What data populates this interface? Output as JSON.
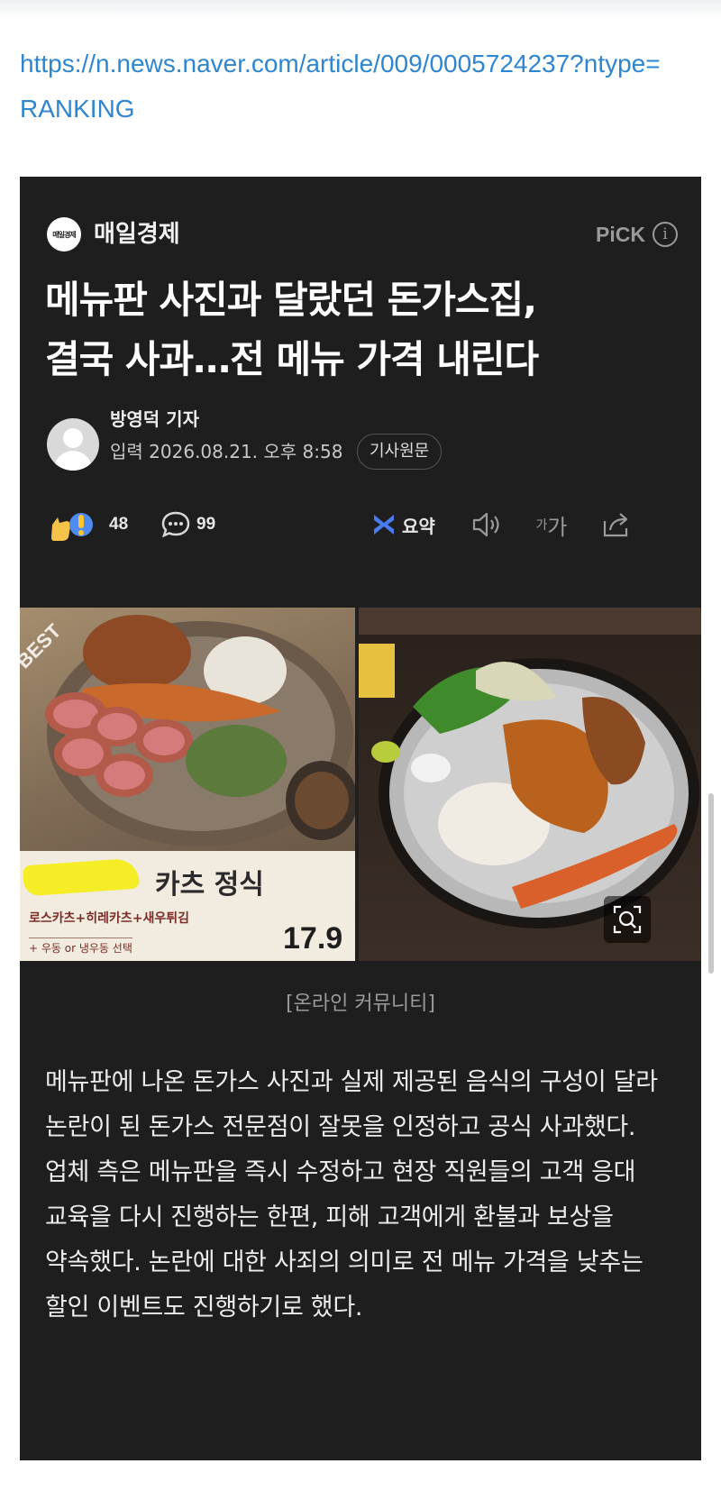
{
  "source_link": "https://n.news.naver.com/article/009/0005724237?ntype=RANKING",
  "article": {
    "press_logo_text": "매일경제",
    "press_name": "매일경제",
    "pick_label": "PiCK",
    "headline_line1": "메뉴판 사진과 달랐던 돈가스집,",
    "headline_line2": "결국 사과…전 메뉴 가격 내린다",
    "reporter": "방영덕 기자",
    "date_label": "입력",
    "date_value": "2026.08.21. 오후 8:58",
    "original_button": "기사원문",
    "reaction_count": "48",
    "comment_count": "99",
    "summary_label": "요약",
    "font_size_label_small": "가",
    "font_size_label_large": "가",
    "photo": {
      "best_tag": "BEST",
      "menu_title": "카츠 정식",
      "menu_sub": "로스카츠+히레카츠+새우튀김",
      "menu_option": "+ 우동 or 냉우동 선택",
      "menu_price": "17.9"
    },
    "caption": "[온라인 커뮤니티]",
    "body": "메뉴판에 나온 돈가스 사진과 실제 제공된 음식의 구성이 달라 논란이 된 돈가스 전문점이 잘못을 인정하고 공식 사과했다. 업체 측은 메뉴판을 즉시 수정하고 현장 직원들의 고객 응대 교육을 다시 진행하는 한편, 피해 고객에게 환불과 보상을 약속했다. 논란에 대한 사죄의 의미로 전 메뉴 가격을 낮추는 할인 이벤트도 진행하기로 했다."
  },
  "colors": {
    "link": "#2e86d1",
    "card_background": "#1e1e1e",
    "summary_icon": "#4a7cf0"
  },
  "icons": [
    "info-icon",
    "reaction-icon",
    "comment-icon",
    "summary-icon",
    "speaker-icon",
    "font-size-icon",
    "share-icon",
    "zoom-icon"
  ]
}
